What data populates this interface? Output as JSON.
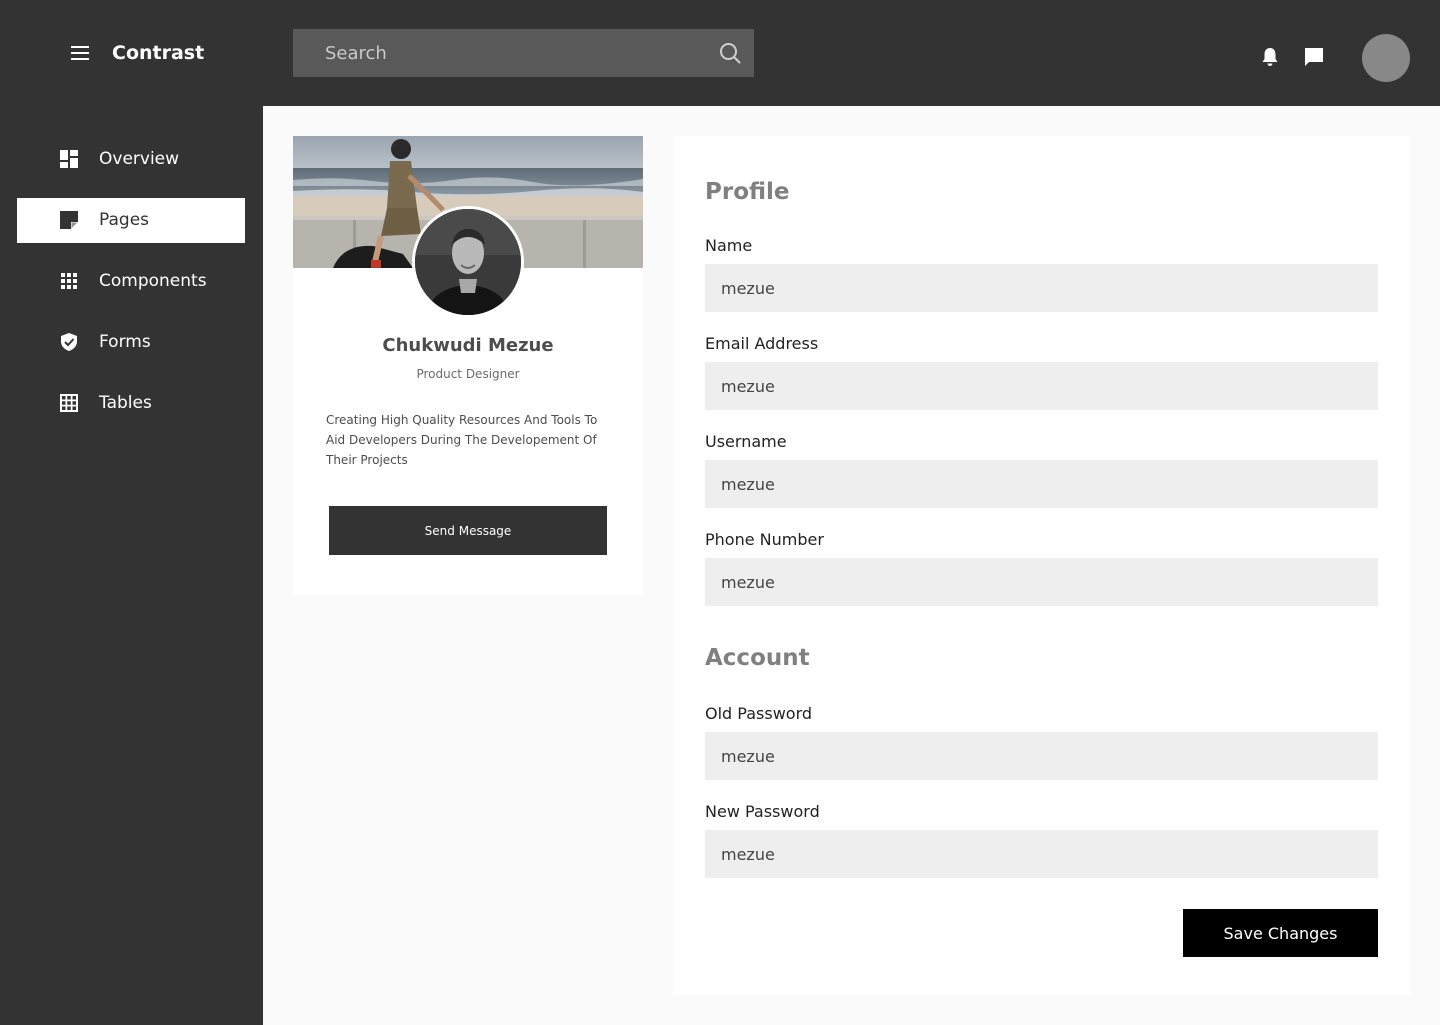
{
  "app": {
    "title": "Contrast"
  },
  "search": {
    "placeholder": "Search"
  },
  "sidebar": {
    "items": [
      {
        "label": "Overview",
        "icon": "dashboard-icon"
      },
      {
        "label": "Pages",
        "icon": "note-icon",
        "active": true
      },
      {
        "label": "Components",
        "icon": "grid-apps-icon"
      },
      {
        "label": "Forms",
        "icon": "shield-check-icon"
      },
      {
        "label": "Tables",
        "icon": "table-icon"
      }
    ]
  },
  "profile_card": {
    "name": "Chukwudi Mezue",
    "role": "Product Designer",
    "bio": "Creating High Quality Resources And Tools To Aid Developers During The Developement Of Their Projects",
    "button_label": "Send Message"
  },
  "settings": {
    "profile_title": "Profile",
    "account_title": "Account",
    "fields": {
      "name": {
        "label": "Name",
        "value": "mezue"
      },
      "email": {
        "label": "Email Address",
        "value": "mezue"
      },
      "username": {
        "label": "Username",
        "value": "mezue"
      },
      "phone": {
        "label": "Phone Number",
        "value": "mezue"
      },
      "old_password": {
        "label": "Old Password",
        "value": "mezue"
      },
      "new_password": {
        "label": "New Password",
        "value": "mezue"
      }
    },
    "save_label": "Save Changes"
  },
  "colors": {
    "background": "#333333",
    "content": "#fafafa",
    "card": "#ffffff",
    "input": "#eeeeee",
    "primary_button": "#000000"
  }
}
